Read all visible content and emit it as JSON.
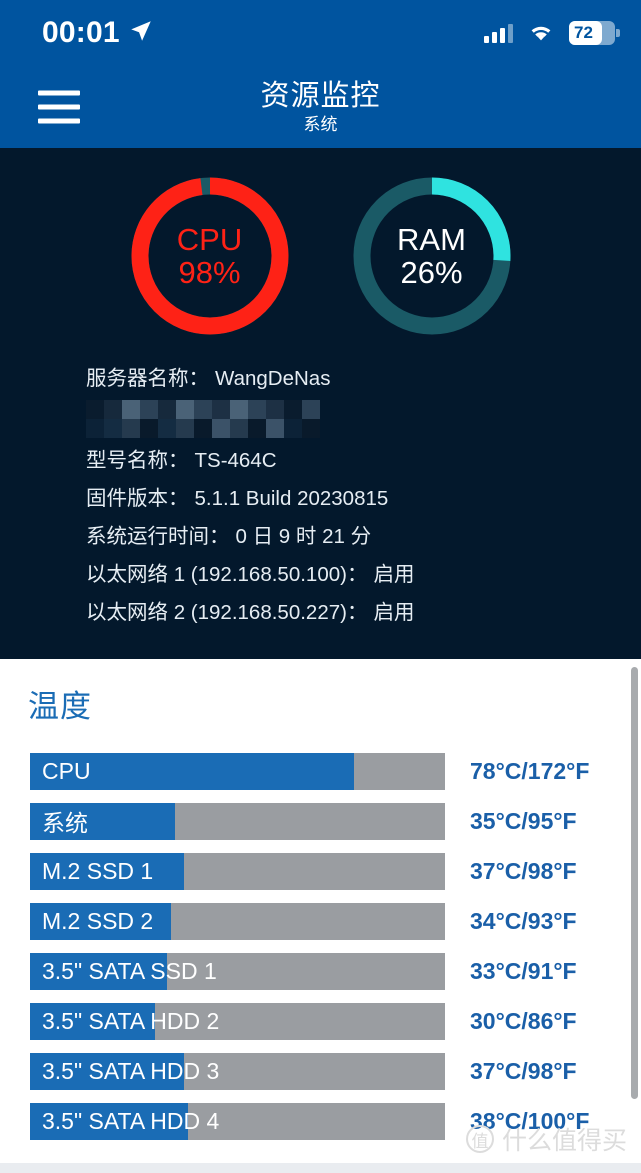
{
  "statusbar": {
    "time": "00:01",
    "location_icon": "location-arrow-icon",
    "signal_icon": "cellular-signal-icon",
    "wifi_icon": "wifi-icon",
    "battery_level": "72",
    "battery_percent": 72
  },
  "header": {
    "menu_icon": "hamburger-menu-icon",
    "title": "资源监控",
    "subtitle": "系统"
  },
  "gauges": [
    {
      "id": "cpu",
      "name": "CPU",
      "value_label": "98%",
      "percent": 98,
      "arc_color": "#fe2216",
      "track_color": "#1a5a66",
      "text_color": "#fe2216"
    },
    {
      "id": "ram",
      "name": "RAM",
      "value_label": "26%",
      "percent": 26,
      "arc_color": "#2fe3e0",
      "track_color": "#1a5a66",
      "text_color": "#ffffff"
    }
  ],
  "system_info": [
    {
      "label": "服务器名称：",
      "value": "WangDeNas"
    },
    {
      "label": "型号名称：",
      "value": "TS-464C"
    },
    {
      "label": "固件版本：",
      "value": "5.1.1 Build 20230815"
    },
    {
      "label": "系统运行时间：",
      "value": "0 日 9 时 21 分"
    },
    {
      "label": "以太网络 1 (192.168.50.100)：",
      "value": "启用"
    },
    {
      "label": "以太网络 2 (192.168.50.227)：",
      "value": "启用"
    }
  ],
  "temperature": {
    "title": "温度",
    "rows": [
      {
        "label": "CPU",
        "value": "78°C/172°F",
        "percent": 78
      },
      {
        "label": "系统",
        "value": "35°C/95°F",
        "percent": 35
      },
      {
        "label": "M.2 SSD 1",
        "value": "37°C/98°F",
        "percent": 37
      },
      {
        "label": "M.2 SSD 2",
        "value": "34°C/93°F",
        "percent": 34
      },
      {
        "label": "3.5\" SATA SSD 1",
        "value": "33°C/91°F",
        "percent": 33
      },
      {
        "label": "3.5\" SATA HDD 2",
        "value": "30°C/86°F",
        "percent": 30
      },
      {
        "label": "3.5\" SATA HDD 3",
        "value": "37°C/98°F",
        "percent": 37
      },
      {
        "label": "3.5\" SATA HDD 4",
        "value": "38°C/100°F",
        "percent": 38
      }
    ]
  },
  "watermark": {
    "mark": "值",
    "text": "什么值得买"
  },
  "colors": {
    "brand_blue": "#00549f",
    "panel_dark": "#03182c",
    "bar_blue": "#1a6cb5",
    "bar_track": "#9a9da1",
    "value_blue": "#1a5fa8",
    "cpu_red": "#fe2216",
    "ram_cyan": "#2fe3e0"
  }
}
